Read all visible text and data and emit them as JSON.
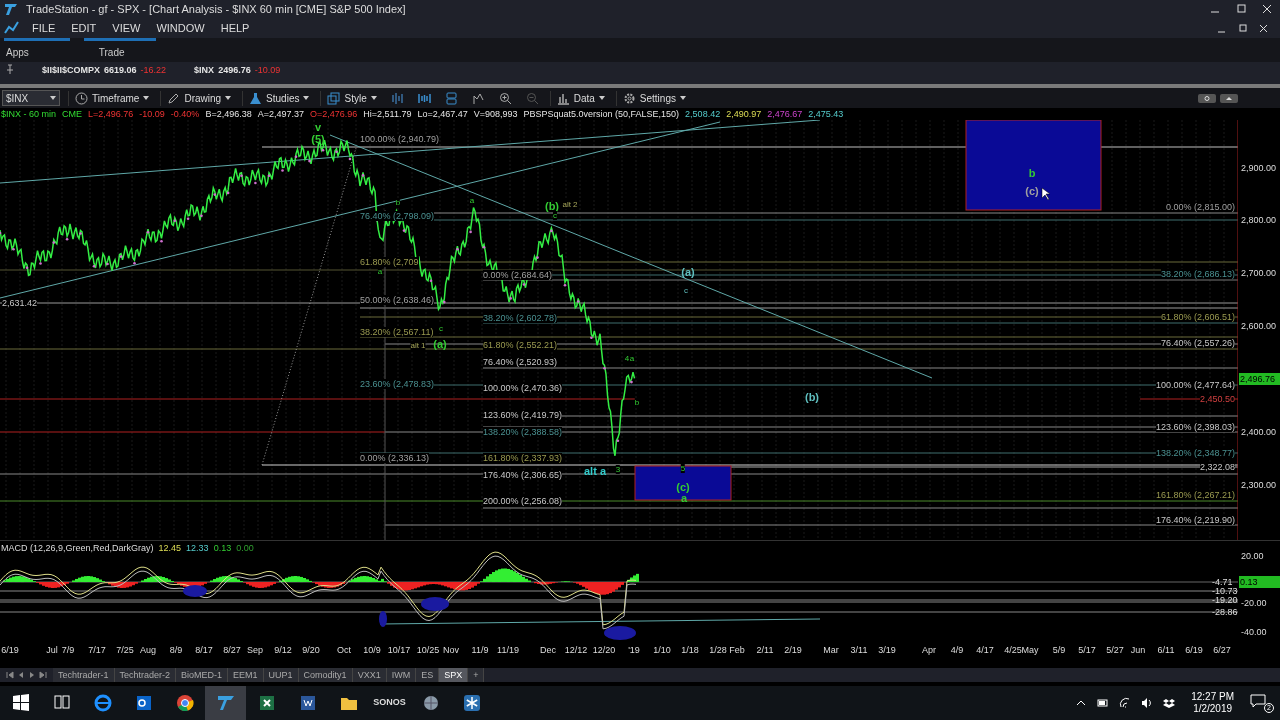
{
  "window": {
    "title": "TradeStation  - gf - SPX - [Chart Analysis - $INX 60 min [CME] S&P 500 Index]"
  },
  "menu": [
    "FILE",
    "EDIT",
    "VIEW",
    "WINDOW",
    "HELP"
  ],
  "workspace_tabs": [
    "Apps",
    "Trade"
  ],
  "tickers": [
    {
      "symbol": "$II$II$COMPX",
      "price": "6619.06",
      "change": "-16.22"
    },
    {
      "symbol": "$INX",
      "price": "2496.76",
      "change": "-10.09"
    }
  ],
  "toolbar": {
    "symbol": "$INX",
    "buttons": [
      "Timeframe",
      "Drawing",
      "Studies",
      "Style",
      "Data",
      "Settings"
    ]
  },
  "status_line": [
    {
      "text": "$INX - 60 min",
      "kind": "symbol"
    },
    {
      "text": "CME",
      "kind": "symbol"
    },
    {
      "text": "L=2,496.76",
      "kind": "down"
    },
    {
      "text": "-10.09",
      "kind": "down"
    },
    {
      "text": "-0.40%",
      "kind": "down"
    },
    {
      "text": "B=2,496.38",
      "kind": "quote"
    },
    {
      "text": "A=2,497.37",
      "kind": "quote"
    },
    {
      "text": "O=2,476.96",
      "kind": "down"
    },
    {
      "text": "Hi=2,511.79",
      "kind": "quote"
    },
    {
      "text": "Lo=2,467.47",
      "kind": "quote"
    },
    {
      "text": "V=908,993",
      "kind": "quote"
    },
    {
      "text": "PBSPSquat5.0version (50,FALSE,150)",
      "kind": "quote"
    },
    {
      "text": "2,508.42",
      "kind": "plot1"
    },
    {
      "text": "2,490.97",
      "kind": "plot2"
    },
    {
      "text": "2,476.67",
      "kind": "plot3"
    },
    {
      "text": "2,475.43",
      "kind": "plot1"
    }
  ],
  "chart": {
    "level_labels": [
      {
        "text": "100.00% (2,940.79)",
        "kind": "primary"
      },
      {
        "text": "76.40% (2,798.09)",
        "kind": "secondary"
      },
      {
        "text": "61.80% (2,709",
        "kind": "tertiary"
      },
      {
        "text": "50.00% (2,638.46)",
        "kind": "primary"
      },
      {
        "text": "38.20% (2,567.11)",
        "kind": "tertiary"
      },
      {
        "text": "23.60% (2,478.83)",
        "kind": "secondary"
      },
      {
        "text": "0.00% (2,336.13)",
        "kind": "primary"
      },
      {
        "text": "0.00% (2,684.64)",
        "kind": "primary"
      },
      {
        "text": "38.20% (2,602.78)",
        "kind": "secondary"
      },
      {
        "text": "61.80% (2,552.21)",
        "kind": "tertiary"
      },
      {
        "text": "76.40% (2,520.93)",
        "kind": "extension"
      },
      {
        "text": "100.00% (2,470.36)",
        "kind": "extension"
      },
      {
        "text": "123.60% (2,419.79)",
        "kind": "extension"
      },
      {
        "text": "138.20% (2,388.58)",
        "kind": "secondary"
      },
      {
        "text": "161.80% (2,337.93)",
        "kind": "tertiary"
      },
      {
        "text": "176.40% (2,306.65)",
        "kind": "extension"
      },
      {
        "text": "200.00% (2,256.08)",
        "kind": "extension"
      },
      {
        "text": "0.00% (2,815.00)",
        "kind": "primary"
      },
      {
        "text": "38.20% (2,686.13)",
        "kind": "secondary"
      },
      {
        "text": "61.80% (2,606.51)",
        "kind": "tertiary"
      },
      {
        "text": "76.40% (2,557.26)",
        "kind": "extension"
      },
      {
        "text": "100.00% (2,477.64)",
        "kind": "extension"
      },
      {
        "text": "2,450.50",
        "kind": "stop"
      },
      {
        "text": "123.60% (2,398.03)",
        "kind": "extension"
      },
      {
        "text": "138.20% (2,348.77)",
        "kind": "secondary"
      },
      {
        "text": "2,322.08",
        "kind": "extension"
      },
      {
        "text": "161.80% (2,267.21)",
        "kind": "tertiary"
      },
      {
        "text": "176.40% (2,219.90)",
        "kind": "extension"
      },
      {
        "text": "2,631.42",
        "kind": "extension"
      }
    ],
    "wave_labels": [
      {
        "text": "v",
        "kind": "wave"
      },
      {
        "text": "(5)",
        "kind": "wave"
      },
      {
        "text": "b",
        "kind": "wave_minor"
      },
      {
        "text": "a",
        "kind": "wave_minor"
      },
      {
        "text": "(b)",
        "kind": "wave"
      },
      {
        "text": "alt 2",
        "kind": "alt"
      },
      {
        "text": "c",
        "kind": "wave_minor"
      },
      {
        "text": "a",
        "kind": "wave_minor"
      },
      {
        "text": "c",
        "kind": "wave_minor"
      },
      {
        "text": "alt 1",
        "kind": "alt"
      },
      {
        "text": "(a)",
        "kind": "wave"
      },
      {
        "text": "4",
        "kind": "wave_minor"
      },
      {
        "text": "a",
        "kind": "wave_minor"
      },
      {
        "text": "b",
        "kind": "wave_minor"
      },
      {
        "text": "alt a",
        "kind": "alt_major"
      },
      {
        "text": "3",
        "kind": "wave_minor"
      },
      {
        "text": "(a)",
        "kind": "count"
      },
      {
        "text": "c",
        "kind": "count_minor"
      },
      {
        "text": "(b)",
        "kind": "count"
      },
      {
        "text": "b",
        "kind": "wave"
      },
      {
        "text": "(c)",
        "kind": "note"
      },
      {
        "text": "5",
        "kind": "wave_minor"
      },
      {
        "text": "(c)",
        "kind": "wave"
      },
      {
        "text": "a",
        "kind": "wave"
      }
    ],
    "price_axis": [
      "2,900.00",
      "2,800.00",
      "2,700.00",
      "2,600.00",
      "2,400.00",
      "2,300.00"
    ],
    "price_tag": "2,496.76"
  },
  "macd": {
    "title": "MACD (12,26,9,Green,Red,DarkGray)",
    "values": [
      {
        "text": "12.45",
        "kind": "macd"
      },
      {
        "text": "12.33",
        "kind": "signal"
      },
      {
        "text": "0.13",
        "kind": "histogram"
      },
      {
        "text": "0.00",
        "kind": "zero"
      }
    ],
    "axis": [
      "20.00",
      "-4.71",
      "-10.73",
      "-19.20",
      "-20.00",
      "-28.86",
      "-40.00"
    ],
    "tag": "0.13"
  },
  "date_axis": [
    "6/19",
    "Jul",
    "7/9",
    "7/17",
    "7/25",
    "Aug",
    "8/9",
    "8/17",
    "8/27",
    "Sep",
    "9/12",
    "9/20",
    "Oct",
    "10/9",
    "10/17",
    "10/25",
    "Nov",
    "11/9",
    "11/19",
    "Dec",
    "12/12",
    "12/20",
    "'19",
    "1/10",
    "1/18",
    "1/28",
    "Feb",
    "2/11",
    "2/19",
    "Mar",
    "3/11",
    "3/19",
    "Apr",
    "4/9",
    "4/17",
    "4/25",
    "May",
    "5/9",
    "5/17",
    "5/27",
    "Jun",
    "6/11",
    "6/19",
    "6/27"
  ],
  "sheet_tabs": [
    {
      "label": "Techtrader-1",
      "selected": false
    },
    {
      "label": "Techtrader-2",
      "selected": false
    },
    {
      "label": "BioMED-1",
      "selected": false
    },
    {
      "label": "EEM1",
      "selected": false
    },
    {
      "label": "UUP1",
      "selected": false
    },
    {
      "label": "Comodity1",
      "selected": false
    },
    {
      "label": "VXX1",
      "selected": false
    },
    {
      "label": "IWM",
      "selected": false
    },
    {
      "label": "ES",
      "selected": false
    },
    {
      "label": "SPX",
      "selected": true
    },
    {
      "label": "+",
      "selected": false
    }
  ],
  "taskbar": {
    "sonos_label": "SONOS",
    "time": "12:27 PM",
    "date": "1/2/2019",
    "notifications": "2"
  }
}
